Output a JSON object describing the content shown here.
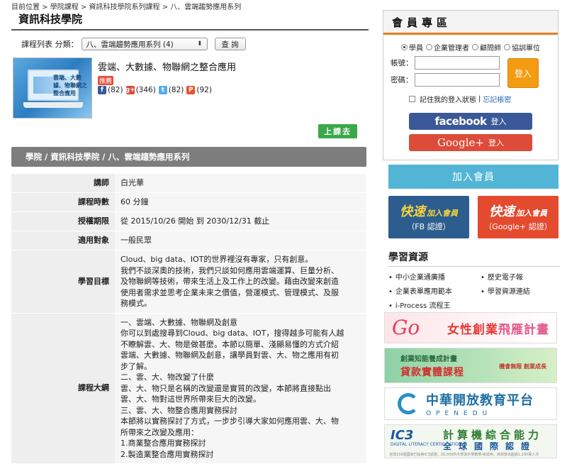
{
  "breadcrumb": "目前位置 > 學院課程 > 資訊科技學院系列課程 > 八、雲端趨勢應用系列",
  "section_title": "資訊科技學院",
  "filter": {
    "label": "課程列表 分類：",
    "selected": "八、雲端趨勢應用系列 (4)",
    "query_button": "查 詢"
  },
  "course": {
    "thumb_caption": "雲端、大數據、物聯網之整合應用",
    "title": "雲端、大數據、物聯網之整合應用",
    "recommend": "推薦",
    "social": [
      {
        "icon": "facebook-icon",
        "glyph": "f",
        "count": "(82)"
      },
      {
        "icon": "google-plus-icon",
        "glyph": "g+",
        "count": "(346)"
      },
      {
        "icon": "twitter-icon",
        "glyph": "t",
        "count": "(82)"
      },
      {
        "icon": "plurk-icon",
        "glyph": "P",
        "count": "(92)"
      }
    ],
    "enroll_button": "上課去"
  },
  "path_bar": "學院 / 資訊科技學院 / 八、雲端趨勢應用系列",
  "details": {
    "instructor_k": "講師",
    "instructor_v": "白光華",
    "duration_k": "課程時數",
    "duration_v": "60 分鐘",
    "period_k": "授權期限",
    "period_v": "從 2015/10/26 開始 到 2030/12/31 截止",
    "audience_k": "適用對象",
    "audience_v": "一般民眾",
    "goal_k": "學習目標",
    "goal_lines": [
      "Cloud、big data、IOT的世界裡沒有專家，只有創意。",
      "我們不談深奧的技術，我們只談如何應用雲端運算、巨量分析、",
      "及物聯網等技術，帶來生活上及工作上的改變。藉由改變來創造",
      "使用者需求並思考企業未來之價值，營運模式、管理模式、及服",
      "務模式。"
    ],
    "outline_k": "課程大綱",
    "outline_lines": [
      "一、雲端、大數據、物聯網及創意",
      "你可以到處搜尋到Cloud、big data、IOT，搜得越多可能有人越",
      "不瞭解雲、大、物是做甚麼。本節以簡單、淺顯易懂的方式介紹",
      "雲端、大數據、物聯網及創意，讓學員對雲、大、物之應用有初",
      "步了解。",
      "二、雲、大、物改變了什麼",
      "雲、大、物只是名稱的改變還是實質的改變，本節將直接點出",
      "雲、大、物對這世界所帶來巨大的改變。",
      "三、雲、大、物整合應用實務探討",
      "本節將以實務探討了方式，一步步引導大家如何應用雲、大、物",
      "所帶來之改變及應用：",
      "1.商業整合應用實務探討",
      "2.製造業整合應用實務探討"
    ]
  },
  "member": {
    "title": "會員專區",
    "roles": [
      "學員",
      "企業管理者",
      "顧問師",
      "協訓單位"
    ],
    "account_label": "帳號：",
    "password_label": "密碼：",
    "login_button": "登入",
    "remember": "記住我的登入狀態",
    "separator": "|",
    "forgot": "忘記帳密",
    "fb_brand": "facebook",
    "fb_login": "登入",
    "gp_brand": "Google+",
    "gp_login": "登入"
  },
  "join_button": "加入會員",
  "quick_fb": {
    "big": "快速",
    "small": "加入會員",
    "sub": "（FB 認證）"
  },
  "quick_gp": {
    "big": "快速",
    "small": "加入會員",
    "sub": "（Google+ 認證）"
  },
  "resources": {
    "title": "學習資源",
    "items": [
      "中小企業通廣播",
      "歷史電子報",
      "企業表單應用範本",
      "學習資源連結",
      "i-Process 流程王"
    ]
  },
  "banners": {
    "women_script": "Go",
    "women_a": "女性創業",
    "women_b": "飛雁計畫",
    "loan_small": "創業知能養成計畫",
    "loan_big": "貸款實體課程",
    "loan_tag": "機會無限 創業成長",
    "openedu_a": "中華開放教育平台",
    "openedu_b": "OPENEDU",
    "ic3_logo": "IC3",
    "ic3_sub": "DIGITAL LITERACY CERTIFICATION",
    "ic3_a": "計算機綜合能力",
    "ic3_b": "全球國際認證",
    "ic3_c": "全球150個國家已採用IC3認證，26,000所大學與中學教學/考試用，目前發出超過1,200萬人次"
  },
  "colors": {
    "accent_orange": "#f39c12",
    "facebook": "#3b5998",
    "google": "#dd4b39",
    "join": "#53b5d6",
    "enroll": "#3aa84a",
    "path_bar": "#7d7d7d"
  }
}
